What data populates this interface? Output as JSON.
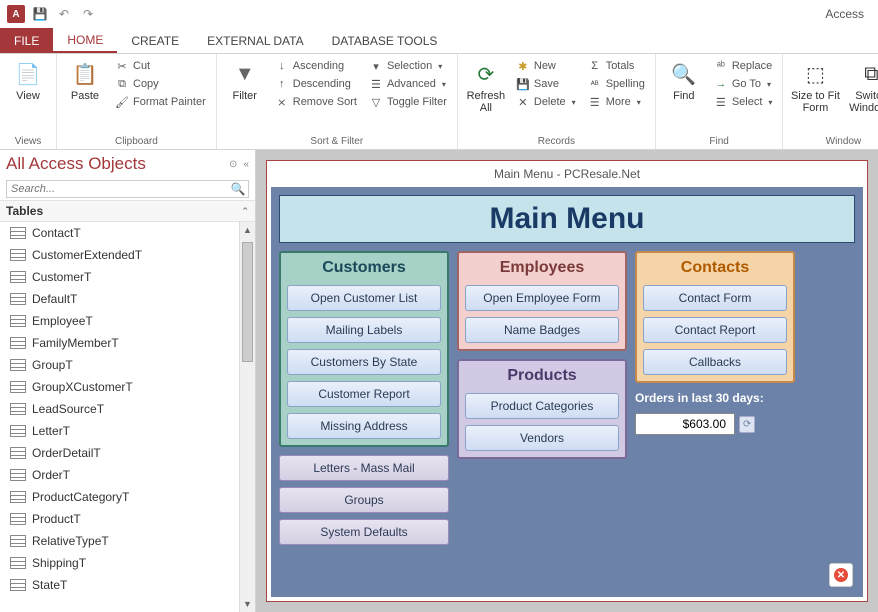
{
  "app": {
    "title": "Access"
  },
  "qat": {
    "save": "💾",
    "undo": "↶",
    "redo": "↷"
  },
  "tabs": {
    "file": "FILE",
    "home": "HOME",
    "create": "CREATE",
    "external": "EXTERNAL DATA",
    "dbtools": "DATABASE TOOLS"
  },
  "ribbon": {
    "views": {
      "label": "Views",
      "view": "View"
    },
    "clipboard": {
      "label": "Clipboard",
      "paste": "Paste",
      "cut": "Cut",
      "copy": "Copy",
      "painter": "Format Painter"
    },
    "sortfilter": {
      "label": "Sort & Filter",
      "filter": "Filter",
      "asc": "Ascending",
      "desc": "Descending",
      "remove": "Remove Sort",
      "selection": "Selection",
      "advanced": "Advanced",
      "toggle": "Toggle Filter"
    },
    "records": {
      "label": "Records",
      "refresh": "Refresh All",
      "new": "New",
      "save": "Save",
      "delete": "Delete",
      "totals": "Totals",
      "spelling": "Spelling",
      "more": "More"
    },
    "find": {
      "label": "Find",
      "find": "Find",
      "replace": "Replace",
      "goto": "Go To",
      "select": "Select"
    },
    "window": {
      "label": "Window",
      "size": "Size to Fit Form",
      "switch": "Switch Windows"
    }
  },
  "nav": {
    "title": "All Access Objects",
    "search_ph": "Search...",
    "group": "Tables",
    "tables": [
      "ContactT",
      "CustomerExtendedT",
      "CustomerT",
      "DefaultT",
      "EmployeeT",
      "FamilyMemberT",
      "GroupT",
      "GroupXCustomerT",
      "LeadSourceT",
      "LetterT",
      "OrderDetailT",
      "OrderT",
      "ProductCategoryT",
      "ProductT",
      "RelativeTypeT",
      "ShippingT",
      "StateT"
    ]
  },
  "form": {
    "caption": "Main Menu - PCResale.Net",
    "title": "Main Menu",
    "customers": {
      "head": "Customers",
      "btns": [
        "Open Customer List",
        "Mailing Labels",
        "Customers By State",
        "Customer Report",
        "Missing Address"
      ]
    },
    "extras": [
      "Letters - Mass Mail",
      "Groups",
      "System Defaults"
    ],
    "employees": {
      "head": "Employees",
      "btns": [
        "Open Employee Form",
        "Name Badges"
      ]
    },
    "products": {
      "head": "Products",
      "btns": [
        "Product Categories",
        "Vendors"
      ]
    },
    "contacts": {
      "head": "Contacts",
      "btns": [
        "Contact Form",
        "Contact Report",
        "Callbacks"
      ]
    },
    "orders": {
      "label": "Orders in last 30 days:",
      "value": "$603.00"
    }
  }
}
